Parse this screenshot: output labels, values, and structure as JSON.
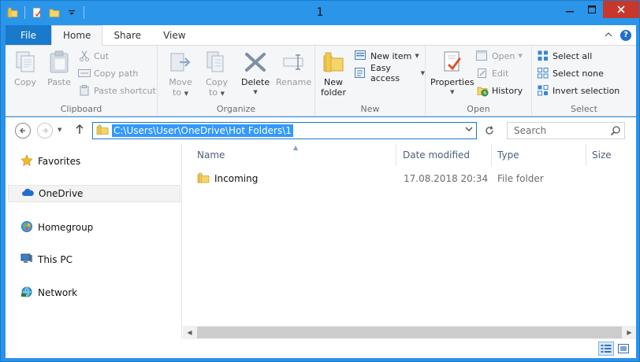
{
  "window": {
    "title": "1"
  },
  "ribbon_tabs": {
    "file": "File",
    "home": "Home",
    "share": "Share",
    "view": "View"
  },
  "clipboard": {
    "group": "Clipboard",
    "copy": "Copy",
    "paste": "Paste",
    "cut": "Cut",
    "copy_path": "Copy path",
    "paste_shortcut": "Paste shortcut"
  },
  "organize": {
    "group": "Organize",
    "move_to_1": "Move",
    "move_to_2": "to",
    "copy_to_1": "Copy",
    "copy_to_2": "to",
    "delete": "Delete",
    "rename": "Rename"
  },
  "new": {
    "group": "New",
    "new_folder_1": "New",
    "new_folder_2": "folder",
    "new_item": "New item",
    "easy_access": "Easy access"
  },
  "open": {
    "group": "Open",
    "properties": "Properties",
    "open": "Open",
    "edit": "Edit",
    "history": "History"
  },
  "select": {
    "group": "Select",
    "select_all": "Select all",
    "select_none": "Select none",
    "invert_selection": "Invert selection"
  },
  "address": {
    "path": "C:\\Users\\User\\OneDrive\\Hot Folders\\1",
    "search_placeholder": "Search"
  },
  "nav_pane": {
    "items": [
      {
        "label": "Favorites",
        "icon": "star-icon"
      },
      {
        "label": "OneDrive",
        "icon": "cloud-icon"
      },
      {
        "label": "Homegroup",
        "icon": "homegroup-icon"
      },
      {
        "label": "This PC",
        "icon": "computer-icon"
      },
      {
        "label": "Network",
        "icon": "network-icon"
      }
    ],
    "selected": "OneDrive"
  },
  "columns": {
    "name": "Name",
    "date": "Date modified",
    "type": "Type",
    "size": "Size"
  },
  "files": [
    {
      "name": "Incoming",
      "date": "17.08.2018 20:34",
      "type": "File folder",
      "icon": "folder-icon"
    }
  ],
  "colors": {
    "titlebar": "#2b95ea",
    "file_tab": "#1979ca",
    "close": "#c7372c",
    "selection": "#3399ff"
  }
}
